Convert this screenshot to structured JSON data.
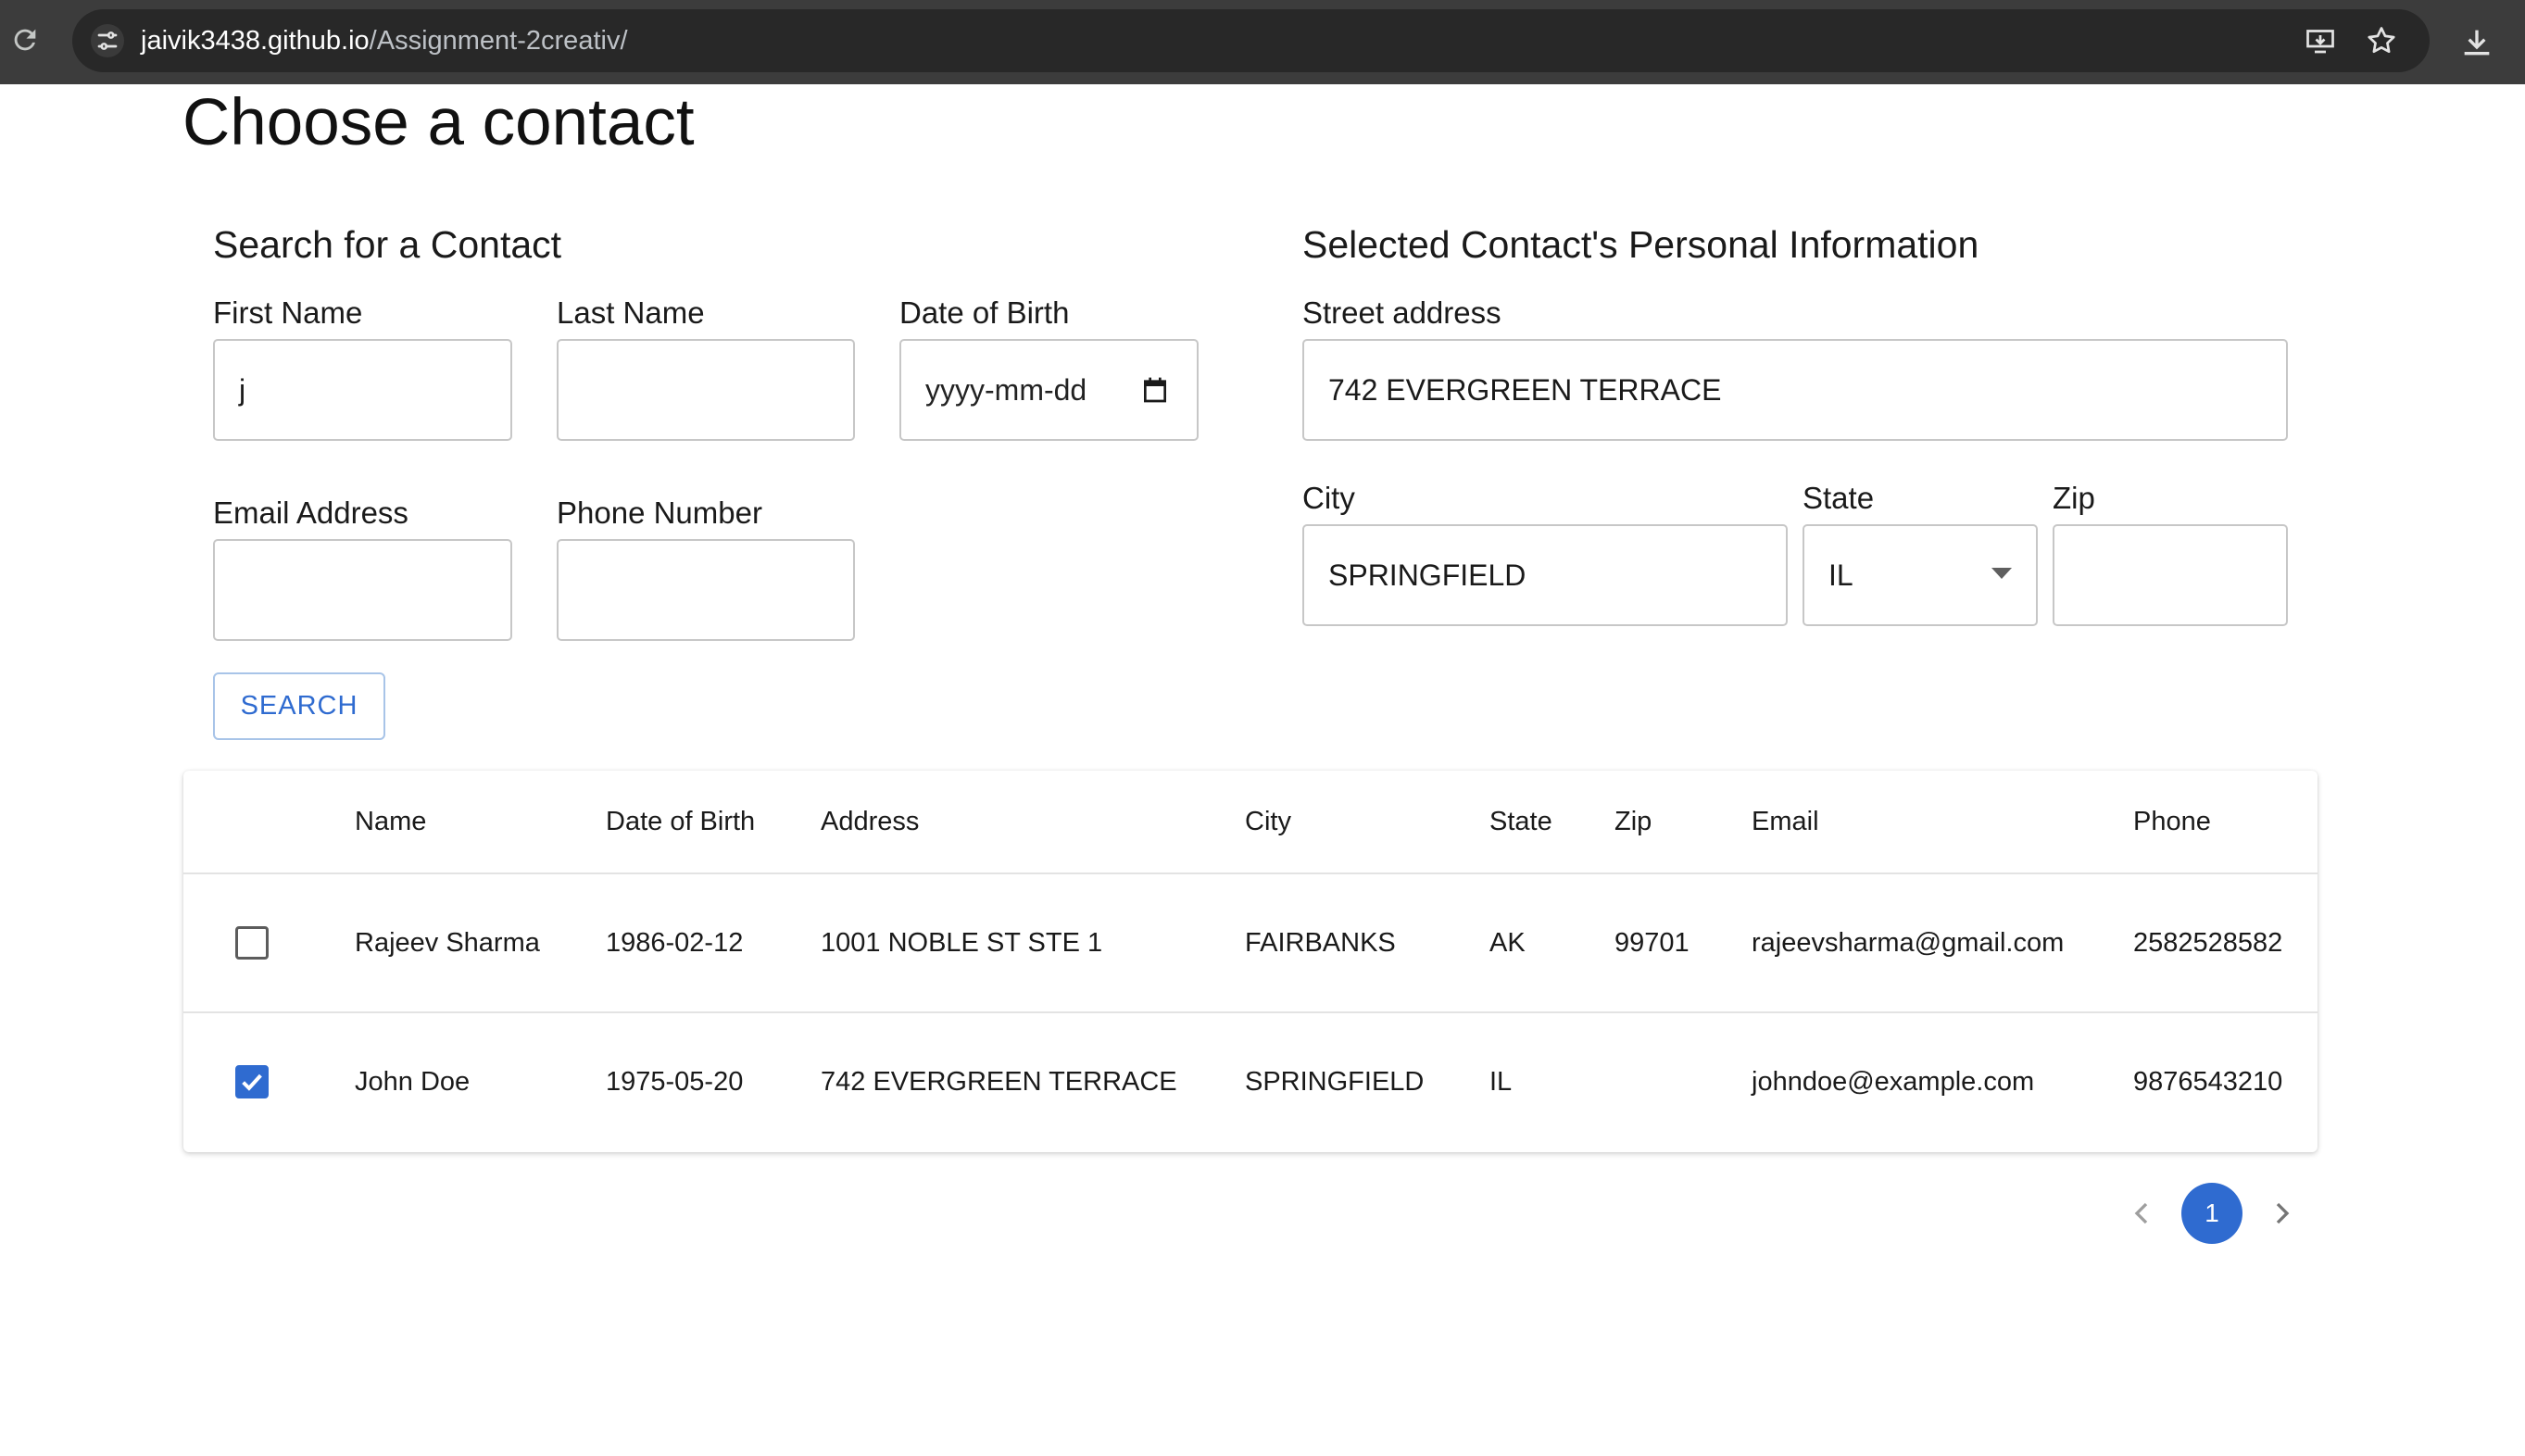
{
  "browser": {
    "url_host": "jaivik3438.github.io",
    "url_path": "/Assignment-2creativ/"
  },
  "page": {
    "title": "Choose a contact"
  },
  "search_section": {
    "title": "Search for a Contact",
    "first_name_label": "First Name",
    "first_name_value": "j",
    "last_name_label": "Last Name",
    "last_name_value": "",
    "dob_label": "Date of Birth",
    "dob_placeholder": "yyyy-mm-dd",
    "email_label": "Email Address",
    "email_value": "",
    "phone_label": "Phone Number",
    "phone_value": "",
    "search_button": "SEARCH"
  },
  "selected_section": {
    "title": "Selected Contact's Personal Information",
    "street_label": "Street address",
    "street_value": "742 EVERGREEN TERRACE",
    "city_label": "City",
    "city_value": "SPRINGFIELD",
    "state_label": "State",
    "state_value": "IL",
    "zip_label": "Zip",
    "zip_value": ""
  },
  "table": {
    "headers": [
      "Name",
      "Date of Birth",
      "Address",
      "City",
      "State",
      "Zip",
      "Email",
      "Phone"
    ],
    "rows": [
      {
        "checked": false,
        "name": "Rajeev Sharma",
        "dob": "1986-02-12",
        "address": "1001 NOBLE ST STE 1",
        "city": "FAIRBANKS",
        "state": "AK",
        "zip": "99701",
        "email": "rajeevsharma@gmail.com",
        "phone": "2582528582"
      },
      {
        "checked": true,
        "name": "John Doe",
        "dob": "1975-05-20",
        "address": "742 EVERGREEN TERRACE",
        "city": "SPRINGFIELD",
        "state": "IL",
        "zip": "",
        "email": "johndoe@example.com",
        "phone": "9876543210"
      }
    ]
  },
  "pagination": {
    "current_page": "1"
  },
  "colors": {
    "accent": "#2f6bd0",
    "browser_bar": "#3c3c3c",
    "omnibox": "#282828"
  }
}
